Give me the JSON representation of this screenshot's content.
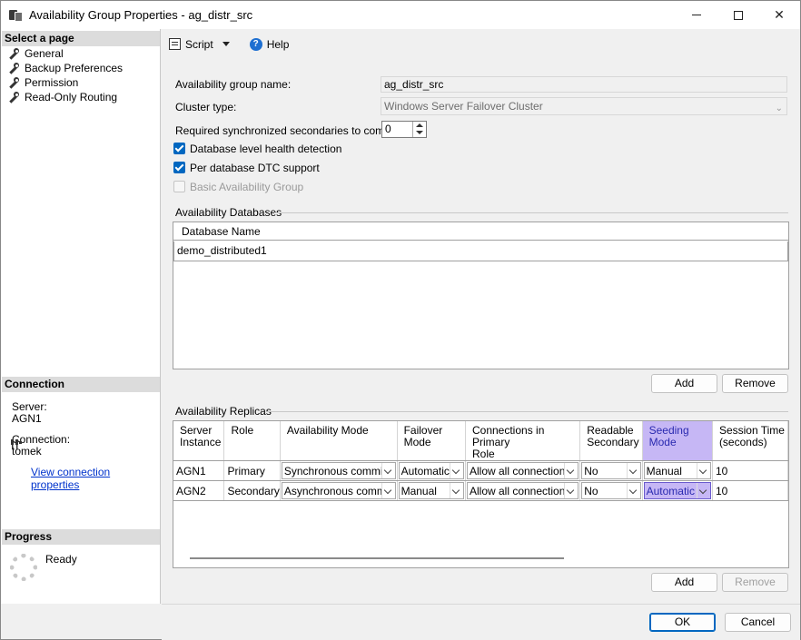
{
  "window": {
    "title": "Availability Group Properties - ag_distr_src",
    "min_glyph": "─",
    "max_glyph": "☐",
    "close_glyph": "✕"
  },
  "left_pane": {
    "select_page_header": "Select a page",
    "pages": [
      "General",
      "Backup Preferences",
      "Permission",
      "Read-Only Routing"
    ],
    "connection_header": "Connection",
    "server_label": "Server:",
    "server_value": "AGN1",
    "connection_label": "Connection:",
    "connection_value": "tomek",
    "view_connection_link": "View connection properties",
    "progress_header": "Progress",
    "progress_status": "Ready"
  },
  "toolbar": {
    "script_label": "Script",
    "help_label": "Help"
  },
  "general": {
    "ag_name_label": "Availability group name:",
    "ag_name_value": "ag_distr_src",
    "cluster_type_label": "Cluster type:",
    "cluster_type_value": "Windows Server Failover Cluster",
    "required_secondaries_label": "Required synchronized secondaries to commit:",
    "required_secondaries_value": "0",
    "db_health_label": "Database level health detection",
    "db_health_checked": true,
    "dtc_label": "Per database DTC support",
    "dtc_checked": true,
    "basic_ag_label": "Basic Availability Group",
    "basic_ag_checked": false
  },
  "databases": {
    "group_label": "Availability Databases",
    "column_header": "Database Name",
    "rows": [
      "demo_distributed1"
    ],
    "add_label": "Add",
    "remove_label": "Remove"
  },
  "replicas": {
    "group_label": "Availability Replicas",
    "headers": [
      "Server Instance",
      "Role",
      "Availability Mode",
      "Failover Mode",
      "Connections in Primary Role",
      "Readable Secondary",
      "Seeding Mode",
      "Session Timeout (seconds)"
    ],
    "header_lines": [
      [
        "Server",
        "Instance"
      ],
      [
        "Role",
        ""
      ],
      [
        "Availability Mode",
        ""
      ],
      [
        "Failover",
        "Mode"
      ],
      [
        "Connections in Primary",
        "Role"
      ],
      [
        "Readable",
        "Secondary"
      ],
      [
        "Seeding",
        "Mode"
      ],
      [
        "Session Time",
        "(seconds)"
      ]
    ],
    "rows": [
      [
        "AGN1",
        "Primary",
        "Synchronous commit",
        "Automatic",
        "Allow all connections",
        "No",
        "Manual",
        "10"
      ],
      [
        "AGN2",
        "Secondary",
        "Asynchronous commit",
        "Manual",
        "Allow all connections",
        "No",
        "Automatic",
        "10"
      ]
    ],
    "add_label": "Add",
    "remove_label": "Remove"
  },
  "dialog": {
    "ok_label": "OK",
    "cancel_label": "Cancel"
  }
}
